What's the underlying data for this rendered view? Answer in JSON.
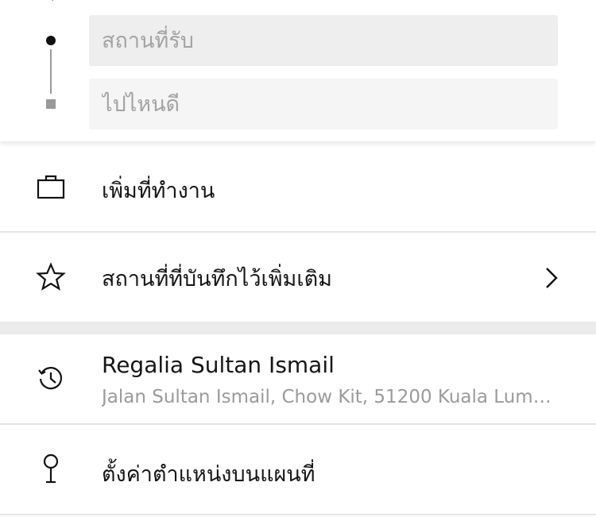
{
  "search": {
    "pickup_placeholder": "สถานที่รับ",
    "destination_placeholder": "ไปไหนดี",
    "back_icon": "chevron-left-icon",
    "pickup_marker": "dot-icon",
    "destination_marker": "square-icon"
  },
  "rows": {
    "add_work": {
      "label": "เพิ่มที่ทำงาน",
      "icon": "briefcase-icon"
    },
    "saved_places": {
      "label": "สถานที่ที่บันทึกไว้เพิ่มเติม",
      "icon": "star-icon",
      "trailing_icon": "chevron-right-icon"
    },
    "recent": {
      "title": "Regalia Sultan Ismail",
      "subtitle": "Jalan Sultan Ismail, Chow Kit, 51200 Kuala Lumpur",
      "icon": "history-icon"
    },
    "set_on_map": {
      "label": "ตั้งค่าตำแหน่งบนแผนที่",
      "icon": "map-pin-icon"
    }
  },
  "colors": {
    "pickup_field_bg": "#eeeeee",
    "destination_field_bg": "#f5f5f5",
    "placeholder_text": "#a3a3a3",
    "secondary_text": "#9b9b9b",
    "divider": "#e4e4e4",
    "section_gap": "#ebebeb"
  }
}
